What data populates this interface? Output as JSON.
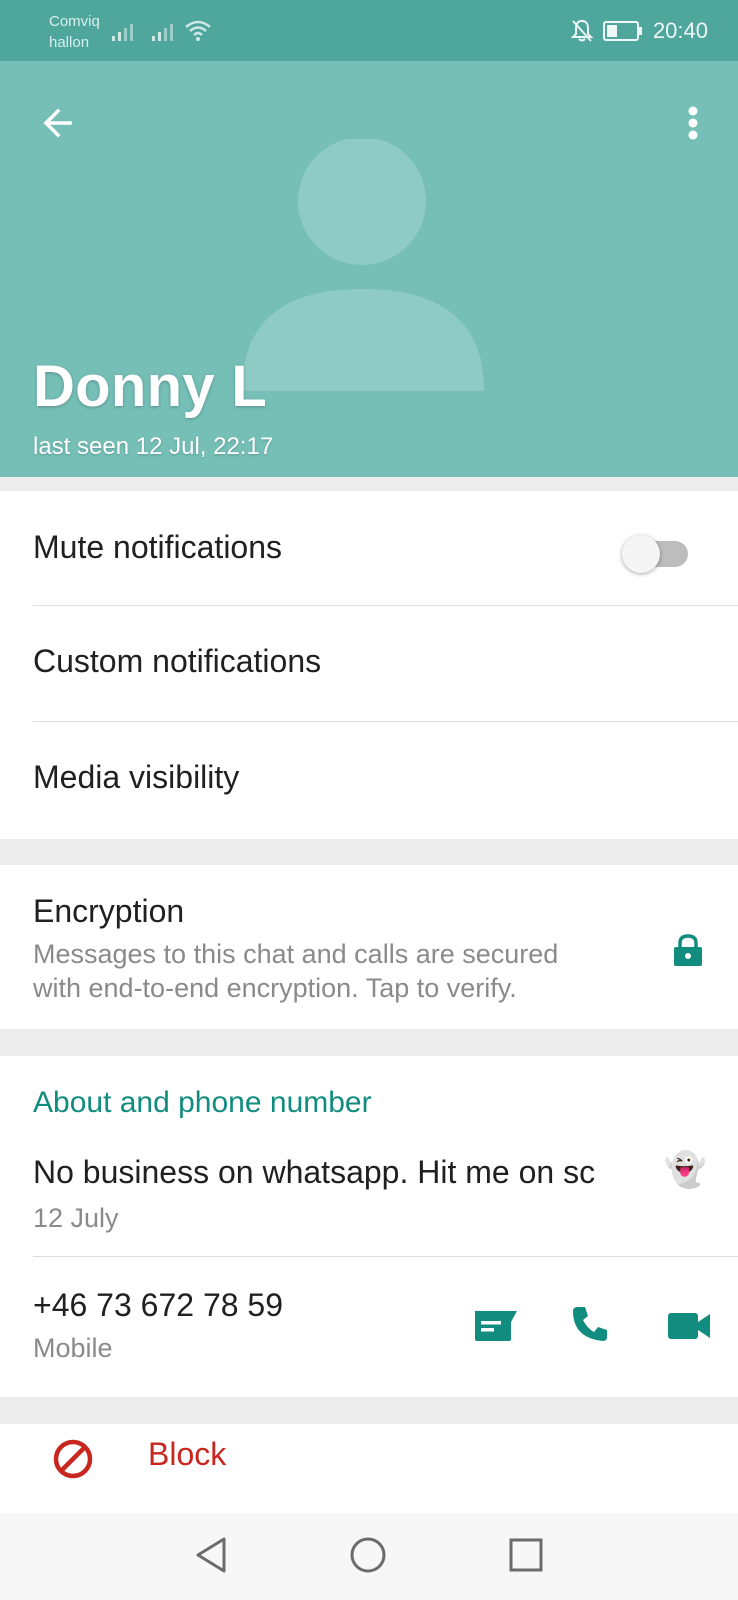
{
  "status_bar": {
    "carrier_line1": "Comviq",
    "carrier_line2": "hallon",
    "time": "20:40"
  },
  "header": {
    "name": "Donny L",
    "last_seen": "last seen 12 Jul, 22:17"
  },
  "notifications": {
    "mute_label": "Mute notifications",
    "mute_enabled": false,
    "custom_label": "Custom notifications",
    "media_label": "Media visibility"
  },
  "encryption": {
    "title": "Encryption",
    "line1": "Messages to this chat and calls are secured",
    "line2": "with end-to-end encryption. Tap to verify."
  },
  "about": {
    "section_title": "About and phone number",
    "status_text": "No business on whatsapp. Hit me on sc",
    "status_emoji": "👻",
    "status_date": "12 July",
    "phone": "+46 73 672 78 59",
    "phone_type": "Mobile"
  },
  "block": {
    "label": "Block"
  },
  "colors": {
    "status_bar": "#4ea69d",
    "header": "#75bfb7",
    "accent": "#128c7e",
    "block_red": "#c8261e"
  },
  "icons": {
    "back": "arrow-left-icon",
    "menu": "more-vert-icon",
    "lock": "lock-icon",
    "message": "message-icon",
    "call": "phone-icon",
    "video": "videocam-icon",
    "block": "block-icon"
  }
}
